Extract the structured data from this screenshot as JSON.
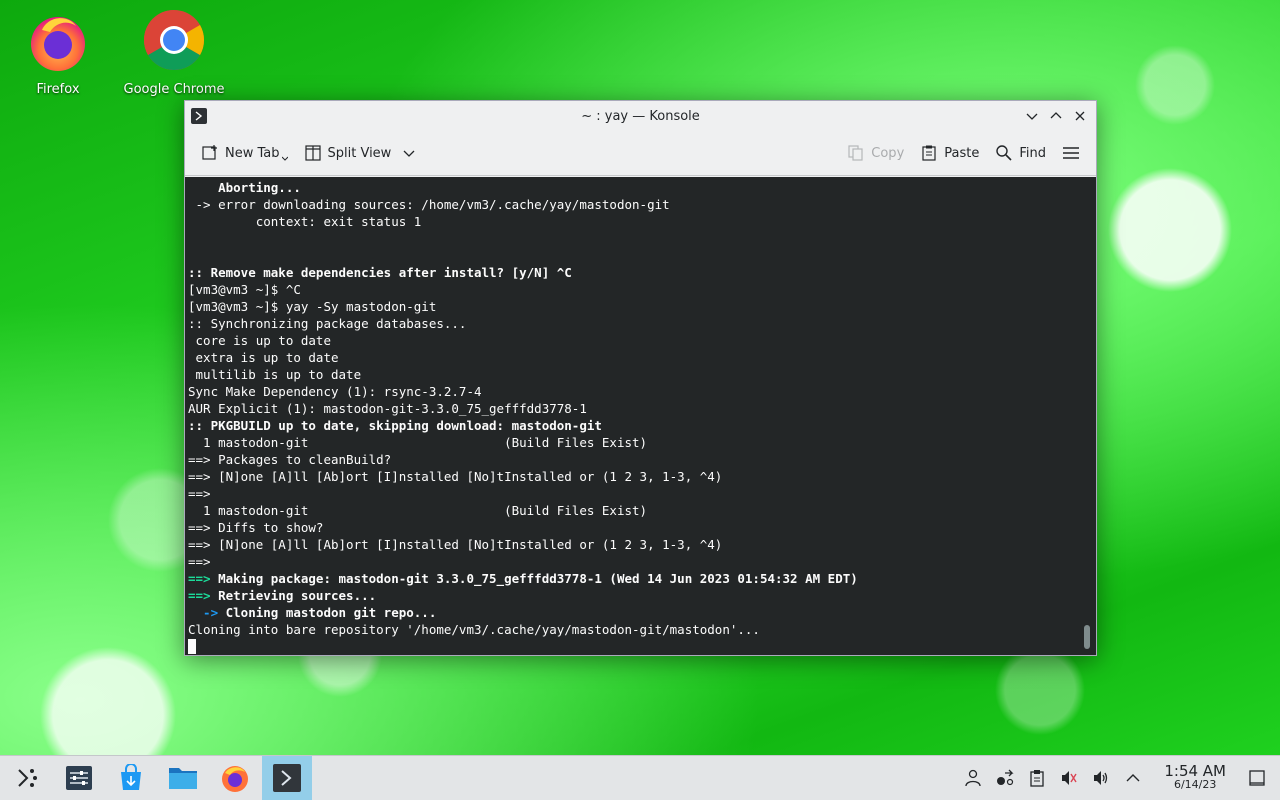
{
  "desktop": {
    "icons": [
      {
        "label": "Firefox"
      },
      {
        "label": "Google Chrome"
      }
    ]
  },
  "window": {
    "title": "~ : yay — Konsole",
    "toolbar": {
      "new_tab": "New Tab",
      "split_view": "Split View",
      "copy": "Copy",
      "paste": "Paste",
      "find": "Find"
    }
  },
  "terminal": {
    "lines": [
      {
        "text": "    Aborting...",
        "bold": true
      },
      {
        "text": " -> error downloading sources: /home/vm3/.cache/yay/mastodon-git"
      },
      {
        "text": "         context: exit status 1"
      },
      {
        "text": ""
      },
      {
        "text": ""
      },
      {
        "text": ":: Remove make dependencies after install? [y/N] ^C",
        "bold": true
      },
      {
        "text": "[vm3@vm3 ~]$ ^C"
      },
      {
        "text": "[vm3@vm3 ~]$ yay -Sy mastodon-git"
      },
      {
        "text": ":: Synchronizing package databases..."
      },
      {
        "text": " core is up to date"
      },
      {
        "text": " extra is up to date"
      },
      {
        "text": " multilib is up to date"
      },
      {
        "text": "Sync Make Dependency (1): rsync-3.2.7-4"
      },
      {
        "text": "AUR Explicit (1): mastodon-git-3.3.0_75_gefffdd3778-1"
      },
      {
        "text": ":: PKGBUILD up to date, skipping download: mastodon-git",
        "bold": true
      },
      {
        "text": "  1 mastodon-git                          (Build Files Exist)"
      },
      {
        "text": "==> Packages to cleanBuild?"
      },
      {
        "text": "==> [N]one [A]ll [Ab]ort [I]nstalled [No]tInstalled or (1 2 3, 1-3, ^4)"
      },
      {
        "text": "==>"
      },
      {
        "text": "  1 mastodon-git                          (Build Files Exist)"
      },
      {
        "text": "==> Diffs to show?"
      },
      {
        "text": "==> [N]one [A]ll [Ab]ort [I]nstalled [No]tInstalled or (1 2 3, 1-3, ^4)"
      },
      {
        "text": "==>"
      },
      {
        "prefix": "==>",
        "text": " Making package: mastodon-git 3.3.0_75_gefffdd3778-1 (Wed 14 Jun 2023 01:54:32 AM EDT)",
        "bold": true,
        "accent": "green"
      },
      {
        "prefix": "==>",
        "text": " Retrieving sources...",
        "bold": true,
        "accent": "green"
      },
      {
        "prefix": "  ->",
        "text": " Cloning mastodon git repo...",
        "bold": true,
        "accent": "blue"
      },
      {
        "text": "Cloning into bare repository '/home/vm3/.cache/yay/mastodon-git/mastodon'..."
      }
    ]
  },
  "taskbar": {
    "clock_time": "1:54 AM",
    "clock_date": "6/14/23"
  },
  "colors": {
    "terminal_bg": "#232627",
    "terminal_fg": "#fcfcfc",
    "accent_green": "#1cdc9a",
    "accent_blue": "#1d99f3",
    "taskbar_active": "#93cee9"
  }
}
